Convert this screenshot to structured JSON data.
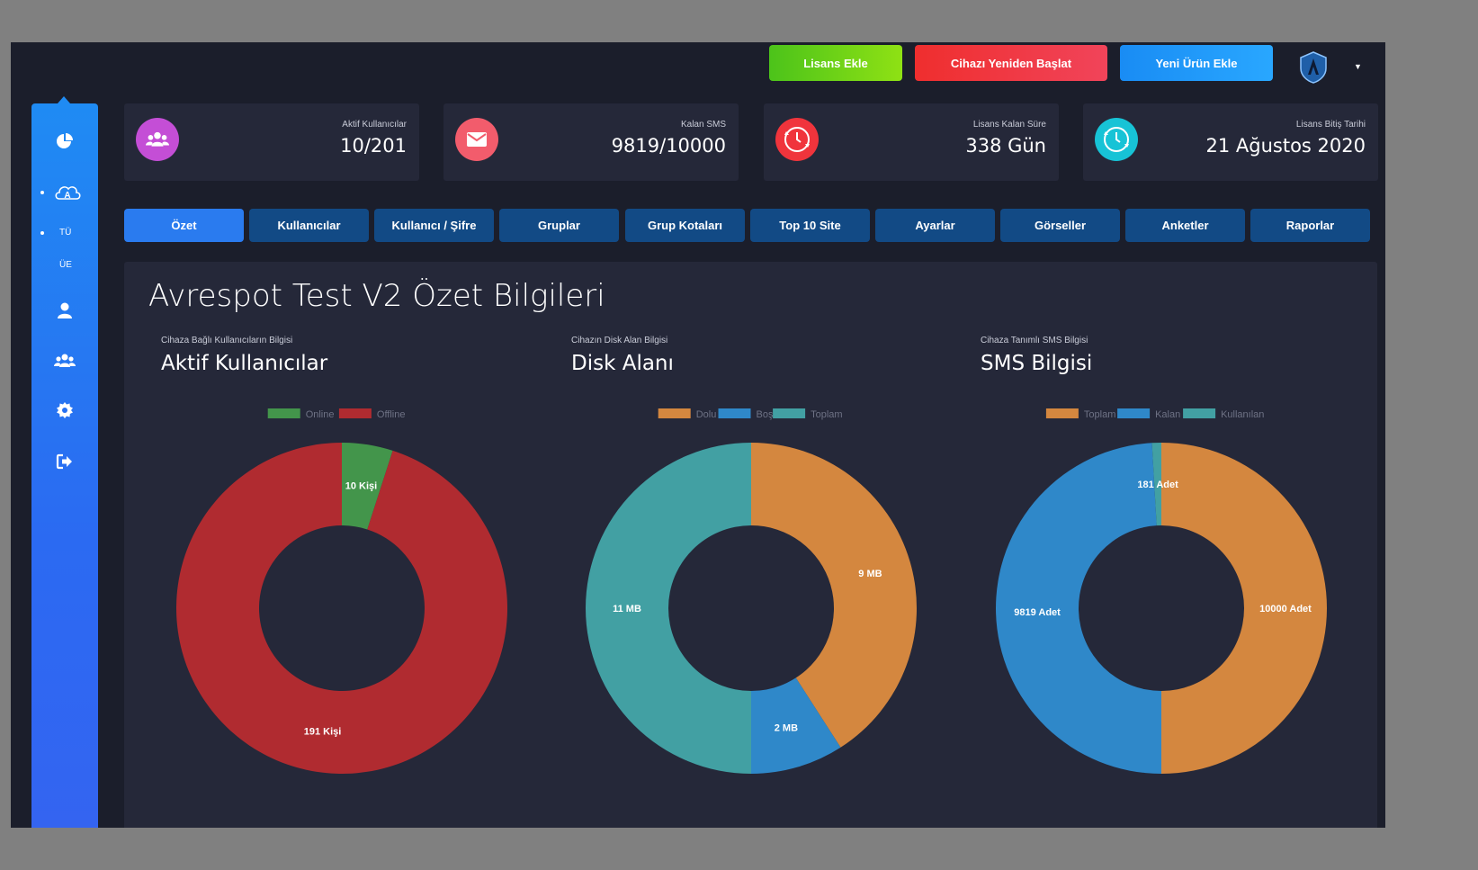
{
  "topbar": {
    "license_add": "Lisans Ekle",
    "restart": "Cihazı Yeniden Başlat",
    "new_product": "Yeni Ürün Ekle",
    "user_icon": "shield-logo-icon"
  },
  "sidebar": {
    "items": [
      {
        "icon": "pie-chart-icon"
      },
      {
        "icon": "cloud-a-icon"
      },
      {
        "label": "TÜ"
      },
      {
        "label": "ÜE"
      },
      {
        "icon": "user-icon"
      },
      {
        "icon": "users-icon"
      },
      {
        "icon": "gear-icon"
      },
      {
        "icon": "sign-out-icon"
      }
    ]
  },
  "stats": [
    {
      "label": "Aktif Kullanıcılar",
      "value": "10/201",
      "color": "#c44ed6",
      "icon": "users-icon"
    },
    {
      "label": "Kalan SMS",
      "value": "9819/10000",
      "color": "#f25c6c",
      "icon": "envelope-icon"
    },
    {
      "label": "Lisans Kalan Süre",
      "value": "338 Gün",
      "color": "#f0343c",
      "icon": "clock-icon"
    },
    {
      "label": "Lisans Bitiş Tarihi",
      "value": "21 Ağustos 2020",
      "color": "#17c3d6",
      "icon": "clock-icon"
    }
  ],
  "tabs": [
    "Özet",
    "Kullanıcılar",
    "Kullanıcı / Şifre",
    "Gruplar",
    "Grup Kotaları",
    "Top 10 Site",
    "Ayarlar",
    "Görseller",
    "Anketler",
    "Raporlar"
  ],
  "page": {
    "title": "Avrespot Test V2 Özet Bilgileri"
  },
  "sections": [
    {
      "subtitle": "Cihaza Bağlı Kullanıcıların Bilgisi",
      "title": "Aktif Kullanıcılar"
    },
    {
      "subtitle": "Cihazın Disk Alan Bilgisi",
      "title": "Disk Alanı"
    },
    {
      "subtitle": "Cihaza Tanımlı SMS Bilgisi",
      "title": "SMS Bilgisi"
    }
  ],
  "chart_data": [
    {
      "type": "pie",
      "legend": [
        "Online",
        "Offline"
      ],
      "values": [
        10,
        191
      ],
      "labels": [
        "10 Kişi",
        "191 Kişi"
      ],
      "colors": [
        "#43954b",
        "#b02b30"
      ]
    },
    {
      "type": "pie",
      "legend": [
        "Dolu",
        "Boş",
        "Toplam"
      ],
      "values": [
        9,
        2,
        11
      ],
      "labels": [
        "9 MB",
        "2 MB",
        "11 MB"
      ],
      "colors": [
        "#d4873f",
        "#2f88c9",
        "#42a0a3"
      ]
    },
    {
      "type": "pie",
      "legend": [
        "Toplam",
        "Kalan",
        "Kullanılan"
      ],
      "values": [
        10000,
        9819,
        181
      ],
      "labels": [
        "10000 Adet",
        "9819 Adet",
        "181 Adet"
      ],
      "colors": [
        "#d4873f",
        "#2f88c9",
        "#42a0a3"
      ]
    }
  ]
}
